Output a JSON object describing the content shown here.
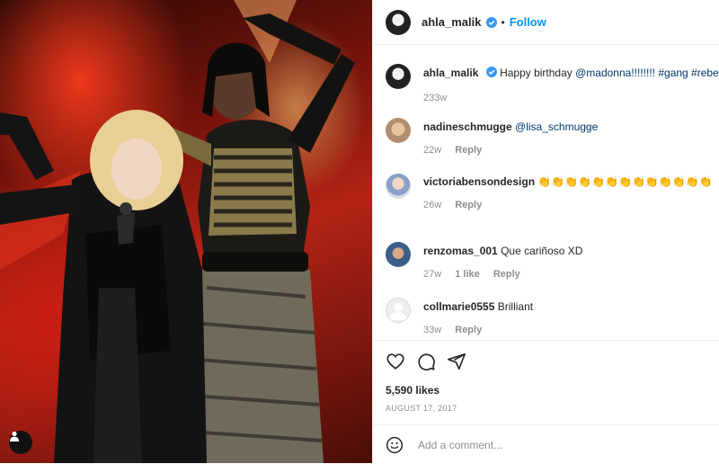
{
  "header": {
    "username": "ahla_malik",
    "separator": "•",
    "follow_label": "Follow",
    "verified_icon": "verified-badge-icon"
  },
  "caption": {
    "username": "ahla_malik",
    "text_prefix": "Happy birthday ",
    "mention": "@madonna",
    "text_suffix": "!!!!!!!! #gang #rebelhe",
    "age": "233w"
  },
  "comments": [
    {
      "username": "nadineschmugge",
      "text": "@lisa_schmugge",
      "text_is_mention": true,
      "age": "22w",
      "likes": "",
      "reply": "Reply"
    },
    {
      "username": "victoriabensondesign",
      "text": "👏👏👏👏👏👏👏👏👏👏👏👏👏👏",
      "text_is_mention": false,
      "age": "26w",
      "likes": "",
      "reply": "Reply"
    },
    {
      "username": "renzomas_001",
      "text": "Que cariñoso XD",
      "text_is_mention": false,
      "age": "27w",
      "likes": "1 like",
      "reply": "Reply"
    },
    {
      "username": "collmarie0555",
      "text": "Brilliant",
      "text_is_mention": false,
      "age": "33w",
      "likes": "",
      "reply": "Reply"
    }
  ],
  "actions": {
    "icons": [
      "heart-icon",
      "comment-icon",
      "share-icon"
    ],
    "likes": "5,590 likes",
    "date": "AUGUST 17, 2017"
  },
  "add_comment": {
    "placeholder": "Add a comment...",
    "icon": "emoji-icon"
  },
  "colors": {
    "accent": "#0095f6",
    "mention": "#00376b",
    "muted": "#8e8e8e",
    "text": "#262626"
  }
}
